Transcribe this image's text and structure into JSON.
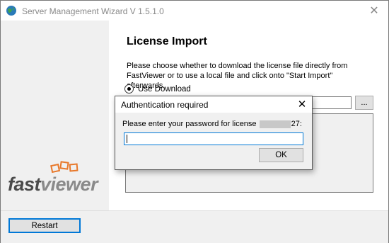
{
  "window": {
    "title": "Server Management Wizard V 1.5.1.0",
    "close_glyph": "✕"
  },
  "logo": {
    "part1": "fast",
    "part2": "viewer"
  },
  "page": {
    "title": "License Import",
    "description": "Please choose whether to download the license file directly from FastViewer or to use a local file and click onto \"Start Import\" afterwards.",
    "radio_download_label": "Use Download",
    "browse_label": "..."
  },
  "footer": {
    "restart_label": "Restart"
  },
  "dialog": {
    "title": "Authentication required",
    "close_glyph": "✕",
    "prompt_before": "Please enter your password for license",
    "prompt_after": "27:",
    "password_value": "",
    "ok_label": "OK"
  },
  "colors": {
    "accent": "#0078d7",
    "sidebar_bg": "#f0f0f0",
    "logo_orange": "#e8782a"
  }
}
